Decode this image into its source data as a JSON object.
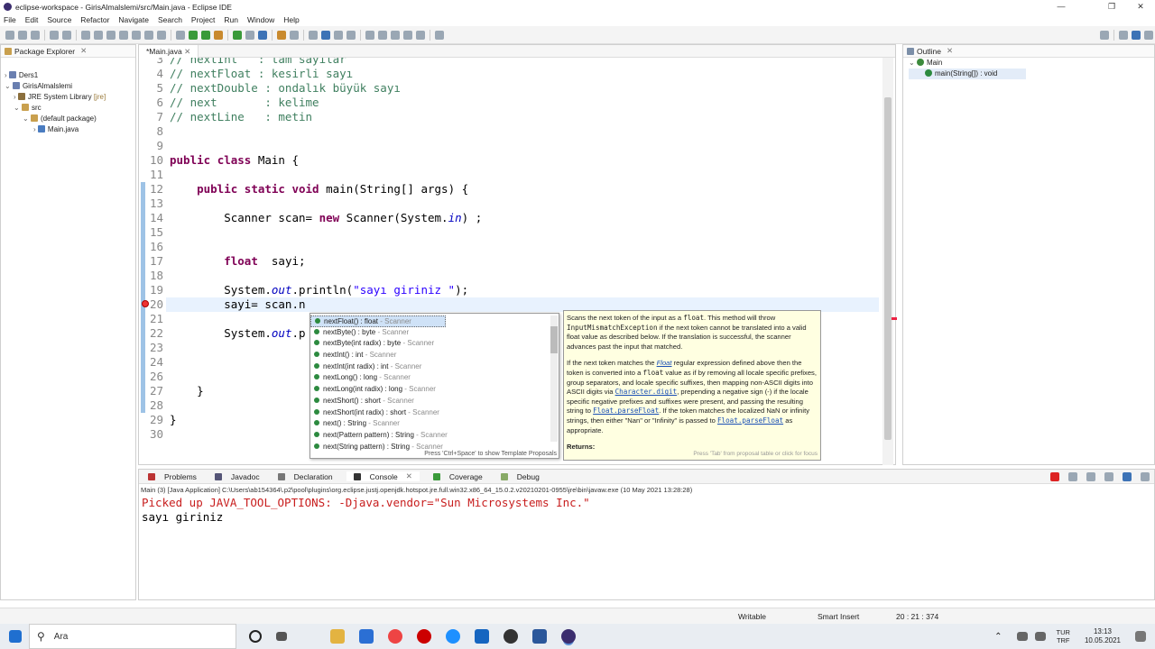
{
  "window": {
    "title": "eclipse-workspace - GirisAlmalslemi/src/Main.java - Eclipse IDE",
    "min": "—",
    "max": "❐",
    "close": "✕"
  },
  "menu": [
    "File",
    "Edit",
    "Source",
    "Refactor",
    "Navigate",
    "Search",
    "Project",
    "Run",
    "Window",
    "Help"
  ],
  "package_explorer": {
    "title": "Package Explorer",
    "items": [
      {
        "label": "Ders1",
        "extra": ""
      },
      {
        "label": "GirisAlmalslemi",
        "extra": ""
      },
      {
        "label": "JRE System Library",
        "extra": "[jre]"
      },
      {
        "label": "src",
        "extra": ""
      },
      {
        "label": "(default package)",
        "extra": ""
      },
      {
        "label": "Main.java",
        "extra": ""
      }
    ]
  },
  "editor": {
    "tab": "*Main.java",
    "lines": [
      {
        "n": "3",
        "c": "// nextInt   : tam sayılar"
      },
      {
        "n": "4",
        "c": "// nextFloat : kesirli sayı"
      },
      {
        "n": "5",
        "c": "// nextDouble : ondalık büyük sayı"
      },
      {
        "n": "6",
        "c": "// next       : kelime"
      },
      {
        "n": "7",
        "c": "// nextLine   : metin"
      },
      {
        "n": "8",
        "c": ""
      },
      {
        "n": "9",
        "c": ""
      },
      {
        "n": "10",
        "c": "public class Main {"
      },
      {
        "n": "11",
        "c": ""
      },
      {
        "n": "12",
        "c": "    public static void main(String[] args) {"
      },
      {
        "n": "13",
        "c": ""
      },
      {
        "n": "14",
        "c": "        Scanner scan= new Scanner(System.in) ;"
      },
      {
        "n": "15",
        "c": ""
      },
      {
        "n": "16",
        "c": ""
      },
      {
        "n": "17",
        "c": "        float  sayi;"
      },
      {
        "n": "18",
        "c": ""
      },
      {
        "n": "19",
        "c": "        System.out.println(\"sayı giriniz \");"
      },
      {
        "n": "20",
        "c": "        sayi= scan.n"
      },
      {
        "n": "21",
        "c": ""
      },
      {
        "n": "22",
        "c": "        System.out.p"
      },
      {
        "n": "23",
        "c": ""
      },
      {
        "n": "24",
        "c": ""
      },
      {
        "n": "26",
        "c": ""
      },
      {
        "n": "27",
        "c": "    }"
      },
      {
        "n": "28",
        "c": ""
      },
      {
        "n": "29",
        "c": "}"
      },
      {
        "n": "30",
        "c": ""
      }
    ]
  },
  "completion": {
    "items": [
      {
        "sig": "nextFloat() : float",
        "cls": " - Scanner"
      },
      {
        "sig": "nextByte() : byte",
        "cls": " - Scanner"
      },
      {
        "sig": "nextByte(int radix) : byte",
        "cls": " - Scanner"
      },
      {
        "sig": "nextInt() : int",
        "cls": " - Scanner"
      },
      {
        "sig": "nextInt(int radix) : int",
        "cls": " - Scanner"
      },
      {
        "sig": "nextLong() : long",
        "cls": " - Scanner"
      },
      {
        "sig": "nextLong(int radix) : long",
        "cls": " - Scanner"
      },
      {
        "sig": "nextShort() : short",
        "cls": " - Scanner"
      },
      {
        "sig": "nextShort(int radix) : short",
        "cls": " - Scanner"
      },
      {
        "sig": "next() : String",
        "cls": " - Scanner"
      },
      {
        "sig": "next(Pattern pattern) : String",
        "cls": " - Scanner"
      },
      {
        "sig": "next(String pattern) : String",
        "cls": " - Scanner"
      }
    ],
    "footer": "Press 'Ctrl+Space' to show Template Proposals"
  },
  "doc": {
    "p1a": "Scans the next token of the input as a ",
    "p1m": "float",
    "p1b": ". This method will throw ",
    "p1m2": "InputMismatchException",
    "p1c": " if the next token cannot be translated into a valid float value as described below. If the translation is successful, the scanner advances past the input that matched.",
    "p2a": "If the next token matches the ",
    "p2link": "Float",
    "p2b": " regular expression defined above then the token is converted into a ",
    "p2m": "float",
    "p2c": " value as if by removing all locale specific prefixes, group separators, and locale specific suffixes, then mapping non-ASCII digits into ASCII digits via ",
    "p2link2": "Character.digit",
    "p2d": ", prepending a negative sign (-) if the locale specific negative prefixes and suffixes were present, and passing the resulting string to ",
    "p2link3": "Float.parseFloat",
    "p2e": ". If the token matches the localized NaN or infinity strings, then either \"Nan\" or \"Infinity\" is passed to ",
    "p2link4": "Float.parseFloat",
    "p2f": " as appropriate.",
    "returns": "Returns:",
    "footer": "Press 'Tab' from proposal table or click for focus"
  },
  "outline": {
    "title": "Outline",
    "class": "Main",
    "method": "main(String[]) : void"
  },
  "console_tabs": [
    "Problems",
    "Javadoc",
    "Declaration",
    "Console",
    "Coverage",
    "Debug"
  ],
  "console": {
    "header": "Main (3) [Java Application] C:\\Users\\ab154364\\.p2\\pool\\plugins\\org.eclipse.justj.openjdk.hotspot.jre.full.win32.x86_64_15.0.2.v20210201-0955\\jre\\bin\\javaw.exe  (10 May 2021 13:28:28)",
    "line1": "Picked up JAVA_TOOL_OPTIONS: -Djava.vendor=\"Sun Microsystems Inc.\"",
    "line2": "sayı giriniz"
  },
  "status": {
    "writable": "Writable",
    "insert": "Smart Insert",
    "pos": "20 : 21 : 374"
  },
  "taskbar": {
    "search": "Ara",
    "lang": "TUR",
    "kb": "TRF",
    "time": "13:13",
    "date": "10.05.2021"
  },
  "colors": {
    "comment": "#3f7f5f",
    "keyword": "#7f0055",
    "string": "#2a00ff",
    "field": "#0000c0",
    "console_err": "#c81e1e"
  }
}
